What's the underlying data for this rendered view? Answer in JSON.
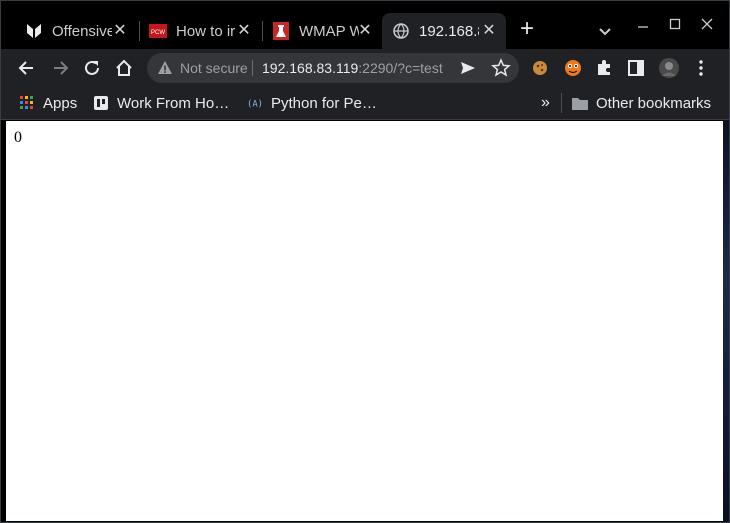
{
  "tabs": [
    {
      "title": "Offensive",
      "favicon": "offensive-security-icon",
      "active": false
    },
    {
      "title": "How to ir",
      "favicon": "pcw-icon",
      "active": false
    },
    {
      "title": "WMAP W",
      "favicon": "wmap-icon",
      "active": false
    },
    {
      "title": "192.168.8",
      "favicon": "globe-icon",
      "active": true
    }
  ],
  "toolbar": {
    "security_label": "Not secure",
    "url_host": "192.168.83.119",
    "url_rest": ":2290/?c=test"
  },
  "bookmarks": {
    "items": [
      {
        "label": "Apps",
        "icon": "apps-grid-icon"
      },
      {
        "label": "Work From Ho…",
        "icon": "work-icon"
      },
      {
        "label": "Python for Pe…",
        "icon": "python-icon"
      }
    ],
    "overflow": "»",
    "other": "Other bookmarks"
  },
  "page": {
    "body_text": "0"
  },
  "colors": {
    "chrome_bg": "#202124",
    "tabstrip_bg": "#000000",
    "omnibox_bg": "#35363a",
    "page_bg": "#ffffff"
  }
}
